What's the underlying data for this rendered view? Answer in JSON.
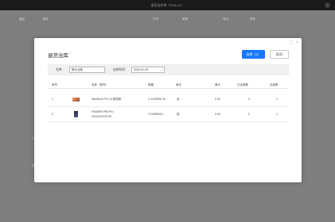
{
  "window": {
    "title": "退货出库单（2011.01）",
    "close_glyph": "×"
  },
  "background": {
    "toolbar": [
      "返回",
      "保存",
      "打印",
      "审核",
      "导出",
      "更多"
    ],
    "marks": [
      "入",
      "销"
    ]
  },
  "modal": {
    "title": "退货出库",
    "ctrl_max": "⛶",
    "ctrl_close": "×",
    "confirm_label": "选择（2）",
    "cancel_label": "取消",
    "filter": {
      "warehouse_label": "仓库",
      "warehouse_value": "默认仓库",
      "date_label": "出库时间",
      "date_value": "2022-01-05",
      "chevron": "⌄"
    },
    "table": {
      "headers": [
        "序号",
        "名称（型号）",
        "规格",
        "单位",
        "单价",
        "已出库数",
        "出库数"
      ],
      "rows": [
        {
          "index": "1",
          "name": "MacBook Pro 14 银色款",
          "spec": "Z-1139991/ M...",
          "unit": "台",
          "price": "0.00",
          "shipped": "0",
          "qty": "1",
          "thumb": "laptop-thumbnail"
        },
        {
          "index": "2",
          "name": "HUAWEI P50 Pro",
          "name2": "2021120115735",
          "spec": "7/14G8/512...",
          "unit": "部",
          "price": "0.00",
          "shipped": "0",
          "qty": "1",
          "thumb": "phone-thumbnail"
        }
      ]
    }
  }
}
